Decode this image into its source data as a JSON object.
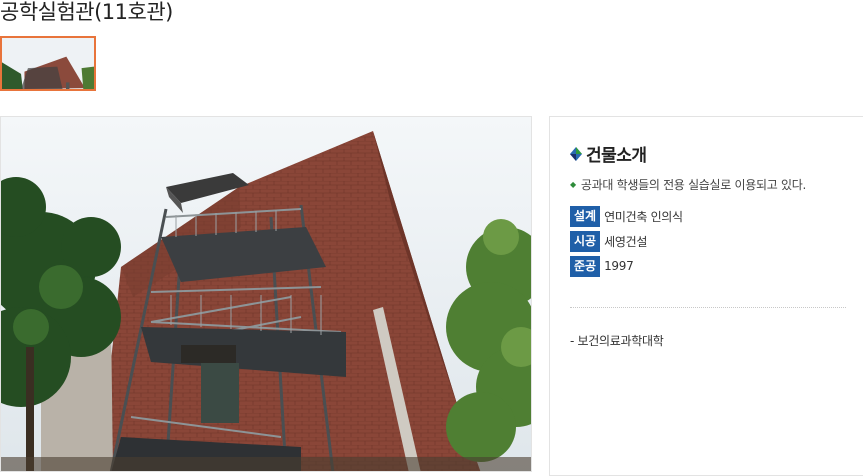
{
  "page": {
    "title": "공학실험관(11호관)"
  },
  "gallery": {
    "thumbnail_alt": "공학실험관(11호관)",
    "selected_color": "#e8743b"
  },
  "info": {
    "heading": "건물소개",
    "intro": "공과대 학생들의 전용 실습실로 이용되고 있다.",
    "facts": [
      {
        "label": "설계",
        "value": "연미건축 인의식"
      },
      {
        "label": "시공",
        "value": "세영건설"
      },
      {
        "label": "준공",
        "value": "1997"
      }
    ],
    "college": "- 보건의료과학대학",
    "badge_color": "#1f5fa8"
  }
}
